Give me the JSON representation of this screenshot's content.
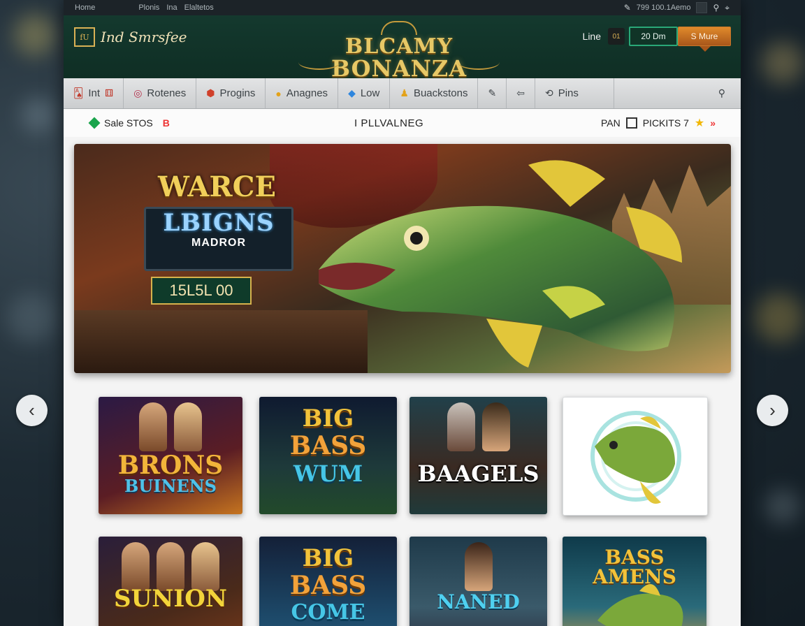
{
  "topbar": {
    "links": [
      "Home",
      "Plonis",
      "Ina",
      "Elaltetos"
    ],
    "status_text": "799 100.1Aemo"
  },
  "header": {
    "site_logo_badge": "fU",
    "site_logo_text": "Ind Smrsfee",
    "brand_line1": "BLCAMY",
    "brand_line2": "BONANZA",
    "line_label": "Line",
    "mini_badge": "01",
    "login_label": "20 Dm",
    "signup_label": "S Mure"
  },
  "nav": {
    "items": [
      {
        "label": "Int",
        "icon": "cards-icon"
      },
      {
        "label": "Rotenes",
        "icon": "ring-icon"
      },
      {
        "label": "Progins",
        "icon": "shield-icon"
      },
      {
        "label": "Anagnes",
        "icon": "coin-icon"
      },
      {
        "label": "Low",
        "icon": "gem-icon"
      },
      {
        "label": "Buackstons",
        "icon": "user-icon"
      },
      {
        "label": "",
        "icon": "pin-icon"
      },
      {
        "label": "",
        "icon": "back-icon"
      },
      {
        "label": "Pins",
        "icon": "sync-icon"
      }
    ]
  },
  "infobar": {
    "sale_label": "Sale STOS",
    "sale_suffix": "B",
    "center_label": "I PLLVALNEG",
    "right_label": "PAN",
    "picks_label": "PICKITS 7"
  },
  "banner": {
    "title": "WARCE",
    "board_top": "LBIGNS",
    "board_bottom": "MADROR",
    "counter": "15L5L 00"
  },
  "games": [
    {
      "title_line1": "BRONS",
      "title_line2": "BUINENS"
    },
    {
      "title_line1": "BIG",
      "title_line2": "BASS",
      "title_line3": "WUM"
    },
    {
      "title_line1": "BAAGELS"
    },
    {
      "title_line1": ""
    },
    {
      "title_line1": "SUNION"
    },
    {
      "title_line1": "BIG",
      "title_line2": "BASS",
      "title_line3": "COME"
    },
    {
      "title_line1": "NANED"
    },
    {
      "title_line1": "BASS AMENS"
    }
  ],
  "colors": {
    "header_green": "#14392e",
    "gold": "#e7c866",
    "accent_orange": "#e08a2b",
    "accent_teal": "#2aa878"
  }
}
